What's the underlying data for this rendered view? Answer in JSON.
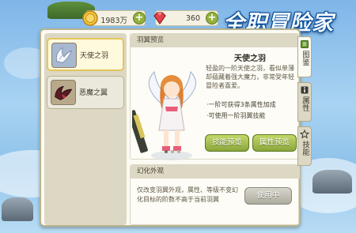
{
  "game_title": "全职冒险家",
  "currency": {
    "gold": "1983万",
    "gems": "360"
  },
  "wing_list": [
    {
      "name": "天使之羽",
      "selected": true
    },
    {
      "name": "恶魔之翼",
      "selected": false
    }
  ],
  "preview": {
    "header": "羽翼预览",
    "wing_name": "天使之羽",
    "description": "轻盈的一阶天使之羽，看似单薄却蕴藏着强大魔力，非常受年轻冒险者喜爱。",
    "features": [
      "·一阶可获得3条属性加成",
      "·可使用一阶羽翼技能"
    ],
    "skill_preview_label": "技能预览",
    "attr_preview_label": "属性预览",
    "pager": {
      "count": 3,
      "active": 0
    }
  },
  "appearance": {
    "header": "幻化外观",
    "description": "仅改变羽翼外观，属性、等级不变幻化目标的阶数不高于当前羽翼",
    "in_use_label": "使用中"
  },
  "side_tabs": [
    {
      "label": "图鉴",
      "icon": "book-icon",
      "active": true
    },
    {
      "label": "属性",
      "icon": "info-icon",
      "active": false
    },
    {
      "label": "技能",
      "icon": "star-icon",
      "active": false
    }
  ],
  "colors": {
    "panel_bg": "#fbfaf3",
    "panel_border": "#b9b38f",
    "green_button": "#8aa73a",
    "gray_button": "#aeab9e",
    "selected_border": "#e3c65a"
  }
}
